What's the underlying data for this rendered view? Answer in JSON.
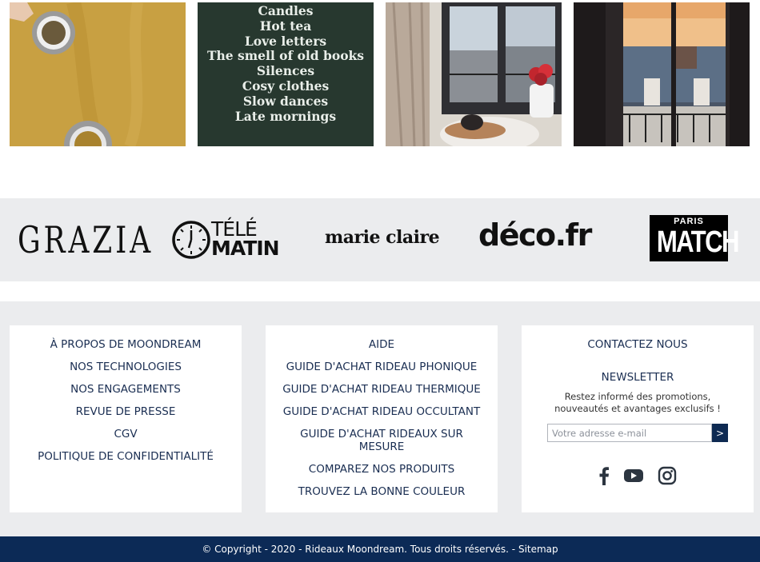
{
  "gallery": {
    "quote_lines": [
      "Candles",
      "Hot tea",
      "Love letters",
      "The smell of old books",
      "Silences",
      "Cosy clothes",
      "Slow dances",
      "Late mornings"
    ]
  },
  "press": {
    "logos": {
      "grazia": "GRAZIA",
      "telematin_top": "TÉLÉ",
      "telematin_bottom": "MATIN",
      "marieclaire": "marie claire",
      "deco": "déco.fr",
      "parismatch_top": "PARIS",
      "parismatch_bottom": "MATCH"
    }
  },
  "footer": {
    "col1": [
      "À PROPOS DE MOONDREAM",
      "NOS TECHNOLOGIES",
      "NOS ENGAGEMENTS",
      "REVUE DE PRESSE",
      "CGV",
      "POLITIQUE DE CONFIDENTIALITÉ"
    ],
    "col2": [
      "AIDE",
      "GUIDE D'ACHAT RIDEAU PHONIQUE",
      "GUIDE D'ACHAT RIDEAU THERMIQUE",
      "GUIDE D'ACHAT RIDEAU OCCULTANT",
      "GUIDE D'ACHAT RIDEAUX SUR MESURE",
      "COMPAREZ NOS PRODUITS",
      "TROUVEZ LA BONNE COULEUR"
    ],
    "contact": {
      "title": "CONTACTEZ NOUS",
      "newsletter_title": "NEWSLETTER",
      "newsletter_text": "Restez informé des promotions, nouveautés et avantages exclusifs !",
      "email_placeholder": "Votre adresse e-mail",
      "submit_label": ">"
    },
    "social": [
      "facebook-icon",
      "youtube-icon",
      "instagram-icon"
    ]
  },
  "copyright": {
    "text": "© Copyright - 2020 - Rideaux Moondream. Tous droits réservés. - ",
    "sitemap": "Sitemap"
  },
  "colors": {
    "navy": "#0c2a56",
    "footer_bg": "#ebecee",
    "link_text": "#1a2e52"
  }
}
